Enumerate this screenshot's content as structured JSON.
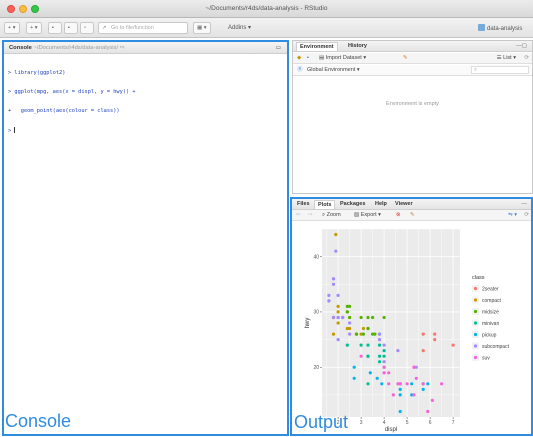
{
  "window": {
    "title": "~/Documents/r4ds/data-analysis - RStudio"
  },
  "toolbar": {
    "new_file": "+",
    "open_project": "+",
    "goto_placeholder": "Go to file/function",
    "layout": "▦ ▾",
    "addins": "Addins ▾",
    "project": "data-analysis"
  },
  "console": {
    "tab": "Console",
    "path": "~/Documents/r4ds/data-analysis/",
    "lines": [
      "> library(ggplot2)",
      "> ggplot(mpg, aes(x = displ, y = hwy)) +",
      "+   geom_point(aes(colour = class))",
      "> "
    ],
    "overlay_label": "Console"
  },
  "environment": {
    "tabs": [
      "Environment",
      "History"
    ],
    "import_dataset": "Import Dataset ▾",
    "list": "List ▾",
    "scope": "Global Environment ▾",
    "empty_message": "Environment is empty"
  },
  "output": {
    "tabs": [
      "Files",
      "Plots",
      "Packages",
      "Help",
      "Viewer"
    ],
    "zoom": "Zoom",
    "export": "Export ▾",
    "overlay_label": "Output"
  },
  "colors": {
    "accent": "#2f8ce0",
    "plot_panel": "#ebebeb"
  },
  "chart_data": {
    "type": "scatter",
    "title": "",
    "xlabel": "displ",
    "ylabel": "hwy",
    "xlim": [
      1.3,
      7.3
    ],
    "ylim": [
      11,
      45
    ],
    "x_ticks": [
      2,
      3,
      4,
      5,
      6,
      7
    ],
    "y_ticks": [
      20,
      30,
      40
    ],
    "grid": true,
    "legend": {
      "title": "class",
      "placement": "right"
    },
    "series": [
      {
        "name": "2seater",
        "color": "#f8766d",
        "points": [
          [
            5.7,
            26
          ],
          [
            5.7,
            23
          ],
          [
            6.2,
            26
          ],
          [
            6.2,
            25
          ],
          [
            7.0,
            24
          ]
        ]
      },
      {
        "name": "compact",
        "color": "#c49a00",
        "points": [
          [
            1.8,
            29
          ],
          [
            1.8,
            29
          ],
          [
            2.0,
            31
          ],
          [
            2.0,
            30
          ],
          [
            2.8,
            26
          ],
          [
            2.8,
            26
          ],
          [
            3.1,
            27
          ],
          [
            1.8,
            26
          ],
          [
            2.0,
            28
          ],
          [
            2.4,
            27
          ],
          [
            2.2,
            29
          ],
          [
            2.5,
            27
          ],
          [
            3.0,
            26
          ],
          [
            1.9,
            44
          ],
          [
            2.0,
            29
          ],
          [
            2.5,
            29
          ]
        ]
      },
      {
        "name": "midsize",
        "color": "#53b400",
        "points": [
          [
            2.4,
            30
          ],
          [
            2.4,
            30
          ],
          [
            3.1,
            26
          ],
          [
            3.5,
            29
          ],
          [
            3.6,
            26
          ],
          [
            2.5,
            29
          ],
          [
            3.3,
            27
          ],
          [
            3.8,
            26
          ],
          [
            3.0,
            29
          ],
          [
            3.3,
            27
          ],
          [
            2.4,
            31
          ],
          [
            2.5,
            31
          ],
          [
            3.5,
            26
          ],
          [
            4.0,
            29
          ],
          [
            3.3,
            29
          ],
          [
            2.8,
            26
          ]
        ]
      },
      {
        "name": "minivan",
        "color": "#00c094",
        "points": [
          [
            2.4,
            24
          ],
          [
            3.0,
            24
          ],
          [
            3.3,
            22
          ],
          [
            3.3,
            22
          ],
          [
            3.8,
            22
          ],
          [
            3.8,
            21
          ],
          [
            4.0,
            23
          ],
          [
            3.3,
            24
          ],
          [
            3.8,
            24
          ],
          [
            4.0,
            22
          ],
          [
            3.3,
            17
          ]
        ]
      },
      {
        "name": "pickup",
        "color": "#00b6eb",
        "points": [
          [
            4.7,
            17
          ],
          [
            4.7,
            12
          ],
          [
            5.2,
            17
          ],
          [
            5.7,
            16
          ],
          [
            5.9,
            17
          ],
          [
            4.7,
            15
          ],
          [
            3.7,
            18
          ],
          [
            3.9,
            17
          ],
          [
            4.7,
            16
          ],
          [
            5.2,
            15
          ],
          [
            2.7,
            20
          ],
          [
            3.4,
            19
          ],
          [
            4.0,
            20
          ],
          [
            4.7,
            17
          ],
          [
            5.7,
            17
          ],
          [
            2.7,
            18
          ]
        ]
      },
      {
        "name": "subcompact",
        "color": "#a58aff",
        "points": [
          [
            1.8,
            35
          ],
          [
            1.6,
            33
          ],
          [
            1.6,
            32
          ],
          [
            1.6,
            32
          ],
          [
            1.8,
            36
          ],
          [
            1.8,
            36
          ],
          [
            1.9,
            41
          ],
          [
            2.0,
            29
          ],
          [
            2.5,
            28
          ],
          [
            3.8,
            26
          ],
          [
            4.0,
            24
          ],
          [
            2.0,
            33
          ],
          [
            2.2,
            29
          ],
          [
            1.8,
            29
          ],
          [
            2.5,
            26
          ],
          [
            3.8,
            25
          ],
          [
            4.6,
            23
          ],
          [
            5.4,
            20
          ],
          [
            4.0,
            21
          ],
          [
            2.0,
            25
          ]
        ]
      },
      {
        "name": "suv",
        "color": "#fb61d7",
        "points": [
          [
            5.3,
            20
          ],
          [
            5.3,
            15
          ],
          [
            5.7,
            17
          ],
          [
            6.5,
            17
          ],
          [
            4.2,
            17
          ],
          [
            4.4,
            15
          ],
          [
            4.7,
            17
          ],
          [
            5.4,
            18
          ],
          [
            4.0,
            19
          ],
          [
            4.6,
            17
          ],
          [
            5.9,
            12
          ],
          [
            4.0,
            20
          ],
          [
            3.0,
            22
          ],
          [
            4.0,
            19
          ],
          [
            5.3,
            20
          ],
          [
            6.1,
            14
          ],
          [
            4.2,
            19
          ],
          [
            5.0,
            17
          ]
        ]
      }
    ]
  }
}
